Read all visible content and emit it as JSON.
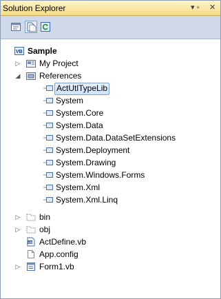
{
  "window": {
    "title": "Solution Explorer",
    "pin_glyph": "▾ ▫",
    "close_glyph": "✕"
  },
  "toolbar": {
    "buttons": [
      {
        "icon": "properties-icon"
      },
      {
        "icon": "show-all-files-icon"
      },
      {
        "icon": "refresh-icon"
      }
    ]
  },
  "tree": {
    "root": {
      "label": "Sample",
      "icon": "vb-project-icon"
    },
    "items": {
      "my_project": {
        "label": "My Project",
        "icon": "my-project-icon",
        "expander": "▷"
      },
      "references": {
        "label": "References",
        "icon": "references-folder-icon",
        "expander": "◢"
      },
      "ref_items": [
        "ActUtlTypeLib",
        "System",
        "System.Core",
        "System.Data",
        "System.Data.DataSetExtensions",
        "System.Deployment",
        "System.Drawing",
        "System.Windows.Forms",
        "System.Xml",
        "System.Xml.Linq"
      ],
      "bin": {
        "label": "bin",
        "icon": "folder-icon",
        "expander": "▷"
      },
      "obj": {
        "label": "obj",
        "icon": "folder-icon",
        "expander": "▷"
      },
      "actdefine": {
        "label": "ActDefine.vb",
        "icon": "vb-file-icon"
      },
      "appconfig": {
        "label": "App.config",
        "icon": "config-file-icon"
      },
      "form1": {
        "label": "Form1.vb",
        "icon": "form-file-icon",
        "expander": "▷"
      }
    }
  },
  "colors": {
    "selection_border": "#7da2ce",
    "titlebar": "#f7dc8b",
    "toolbar": "#cfd9ea"
  }
}
